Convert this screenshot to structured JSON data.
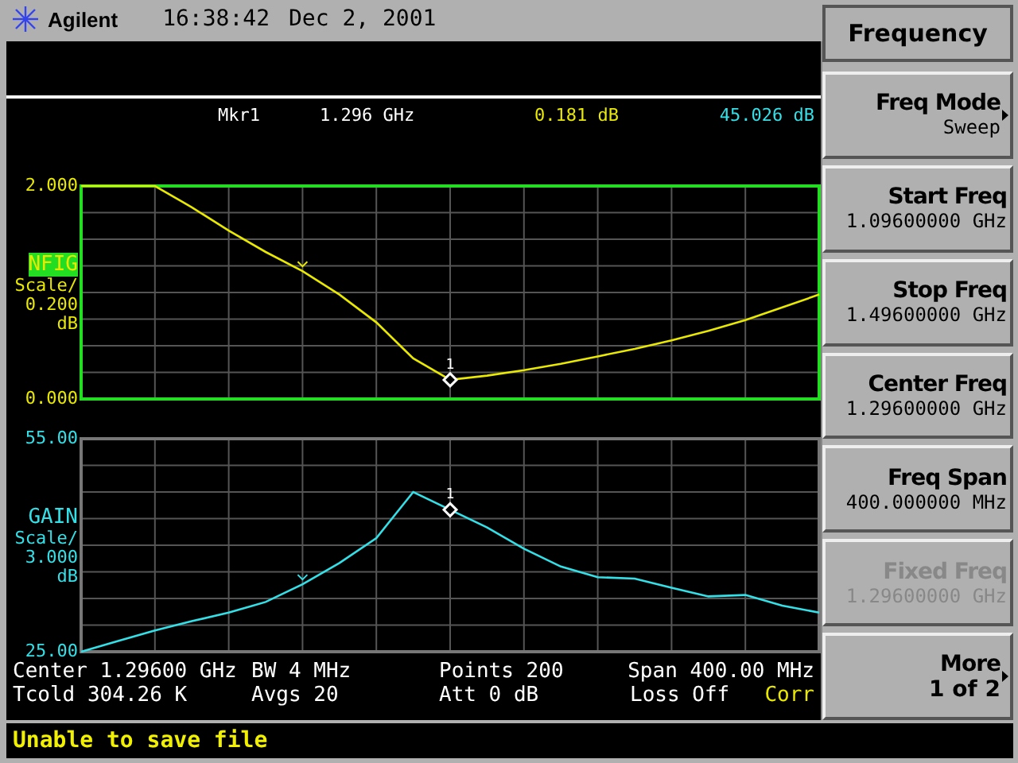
{
  "header": {
    "brand": "Agilent",
    "time": "16:38:42",
    "date": "Dec 2, 2001"
  },
  "marker": {
    "label": "Mkr1",
    "frequency": "1.296 GHz",
    "readings": [
      {
        "text": "0.181 dB",
        "color": "#e8e800"
      },
      {
        "text": "45.026 dB",
        "color": "#33e0e8"
      }
    ]
  },
  "graphs": [
    {
      "active": true,
      "scale_label": "Scale/",
      "scale": "0.200",
      "unit": "dB",
      "marker_label": "1",
      "chart_data": {
        "type": "line",
        "grid": true,
        "ylim": [
          0,
          2
        ],
        "yticks": [
          {
            "value": 0,
            "label": "0.000"
          },
          {
            "value": 2,
            "label": "2.000"
          }
        ],
        "categories": [
          null,
          null,
          null,
          null,
          null,
          null,
          null,
          null,
          null,
          null,
          null,
          null,
          null,
          null,
          null,
          null,
          null,
          null,
          null,
          null,
          null
        ],
        "series": [
          {
            "name": "NFIG",
            "color": "#e8e800",
            "values": [
              2.0,
              2.0,
              2.0,
              1.8,
              1.58,
              1.38,
              1.2,
              0.98,
              0.72,
              0.38,
              0.18,
              0.22,
              0.27,
              0.33,
              0.4,
              0.47,
              0.55,
              0.64,
              0.74,
              0.86,
              0.98
            ]
          }
        ]
      }
    },
    {
      "active": false,
      "scale_label": "Scale/",
      "scale": "3.000",
      "unit": "dB",
      "marker_label": "1",
      "chart_data": {
        "type": "line",
        "grid": true,
        "ylim": [
          25,
          55
        ],
        "yticks": [
          {
            "value": 25,
            "label": "25.00"
          },
          {
            "value": 55,
            "label": "55.00"
          }
        ],
        "categories": [
          null,
          null,
          null,
          null,
          null,
          null,
          null,
          null,
          null,
          null,
          null,
          null,
          null,
          null,
          null,
          null,
          null,
          null,
          null,
          null,
          null
        ],
        "series": [
          {
            "name": "GAIN",
            "color": "#33e0e8",
            "values": [
              25.0,
              26.5,
              28.0,
              29.3,
              30.5,
              32.0,
              34.5,
              37.5,
              41.0,
              47.5,
              45.0,
              42.5,
              39.5,
              37.0,
              35.5,
              35.3,
              34.0,
              32.8,
              33.0,
              31.5,
              30.5
            ]
          }
        ]
      }
    }
  ],
  "footer": [
    {
      "text": "Center 1.29600 GHz",
      "highlight": false
    },
    {
      "text": "BW 4 MHz",
      "highlight": false
    },
    {
      "text": "Points 200",
      "highlight": false
    },
    {
      "text": "Span 400.00 MHz",
      "highlight": false
    },
    {
      "text": "Tcold 304.26 K",
      "highlight": false
    },
    {
      "text": "Avgs 20",
      "highlight": false
    },
    {
      "text": "Att 0 dB",
      "highlight": false
    },
    {
      "text": "Loss Off",
      "highlight": false
    },
    {
      "text": "Corr",
      "highlight": true
    }
  ],
  "message": "Unable to save file",
  "menu": {
    "title": "Frequency",
    "keys": [
      {
        "kind": "submenu",
        "label": "Freq Mode",
        "value": "Sweep",
        "disabled": false
      },
      {
        "kind": "value",
        "label": "Start Freq",
        "value": "1.09600000 GHz",
        "disabled": false
      },
      {
        "kind": "value",
        "label": "Stop Freq",
        "value": "1.49600000 GHz",
        "disabled": false
      },
      {
        "kind": "value",
        "label": "Center Freq",
        "value": "1.29600000 GHz",
        "disabled": false
      },
      {
        "kind": "value",
        "label": "Freq Span",
        "value": "400.000000 MHz",
        "disabled": false
      },
      {
        "kind": "value",
        "label": "Fixed Freq",
        "value": "1.29600000 GHz",
        "disabled": true
      },
      {
        "kind": "more",
        "label": "More",
        "value": "1 of 2",
        "disabled": false
      }
    ]
  }
}
